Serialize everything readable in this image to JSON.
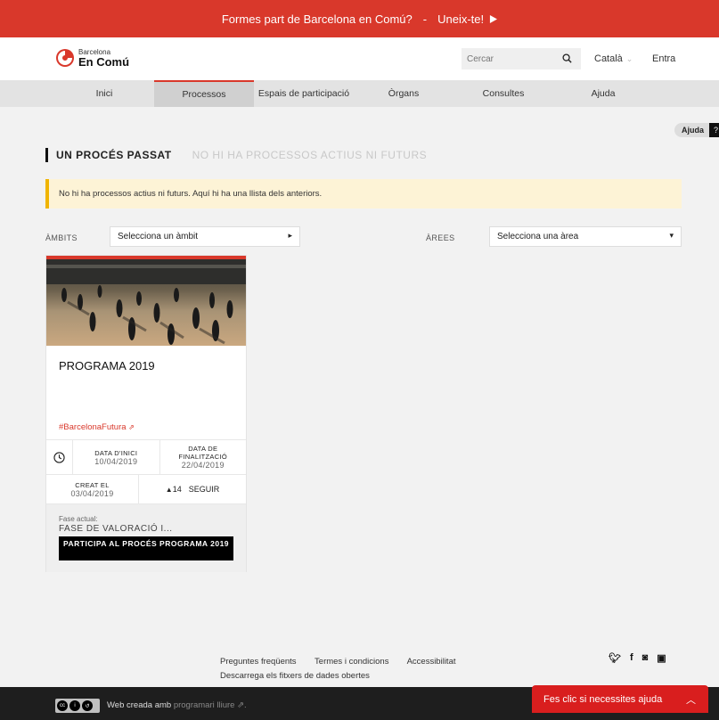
{
  "banner": {
    "question": "Formes part de Barcelona en Comú?",
    "separator": "-",
    "cta": "Uneix-te!"
  },
  "header": {
    "logo_line1": "Barcelona",
    "logo_line2": "En Comú",
    "search_placeholder": "Cercar",
    "language": "Català",
    "login": "Entra"
  },
  "nav": {
    "items": [
      {
        "label": "Inici"
      },
      {
        "label": "Processos"
      },
      {
        "label": "Espais de participació"
      },
      {
        "label": "Òrgans"
      },
      {
        "label": "Consultes"
      },
      {
        "label": "Ajuda"
      }
    ],
    "active": "Processos"
  },
  "help_tag": {
    "label": "Ajuda",
    "icon": "?"
  },
  "filters": {
    "past_tab": "UN PROCÉS PASSAT",
    "active_tab": "NO HI HA PROCESSOS ACTIUS NI FUTURS",
    "notice": "No hi ha processos actius ni futurs. Aquí hi ha una llista dels anteriors.",
    "scope_label": "ÀMBITS",
    "scope_select": "Selecciona un àmbit",
    "area_label": "ÀREES",
    "area_select": "Selecciona una àrea"
  },
  "card": {
    "title": "PROGRAMA 2019",
    "hashtag": "#BarcelonaFutura",
    "start_label": "DATA D'INICI",
    "start_date": "10/04/2019",
    "end_label_1": "DATA DE",
    "end_label_2": "FINALITZACIÓ",
    "end_date": "22/04/2019",
    "created_label": "CREAT EL",
    "created_date": "03/04/2019",
    "followers": "14",
    "follow_label": "SEGUIR",
    "phase_label": "Fase actual:",
    "phase_value": "FASE DE VALORACIÓ I...",
    "button_label": "PARTICIPA AL PROCÉS PROGRAMA 2019"
  },
  "footer": {
    "links": [
      "Preguntes freqüents",
      "Termes i condicions",
      "Accessibilitat"
    ],
    "download": "Descarrega els fitxers de dades obertes",
    "social_icons": [
      "twitter-icon",
      "facebook-icon",
      "instagram-icon",
      "youtube-icon"
    ],
    "made_with": "Web creada amb",
    "software": "programari lliure",
    "help_button": "Fes clic si necessites ajuda"
  },
  "colors": {
    "brand_red": "#d9382b",
    "notice_yellow": "#f0b400"
  }
}
